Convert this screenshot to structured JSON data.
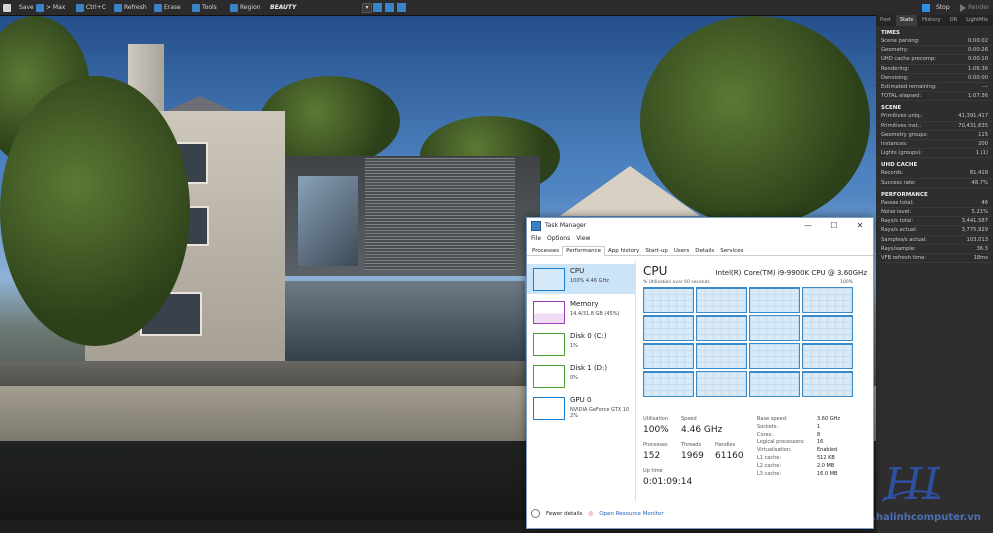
{
  "toolbar": {
    "save": "Save",
    "max": "> Max",
    "ctrlc": "Ctrl+C",
    "refresh": "Refresh",
    "erase": "Erase",
    "tools": "Tools",
    "region": "Region",
    "region_name": "BEAUTY",
    "stop": "Stop",
    "render": "Render"
  },
  "panel": {
    "tabs": [
      "Post",
      "Stats",
      "History",
      "DR",
      "LightMix"
    ],
    "active_tab": "Stats",
    "sections": [
      {
        "title": "TIMES",
        "rows": [
          [
            "Scene parsing:",
            "0:00:02"
          ],
          [
            "Geometry:",
            "0:00:26"
          ],
          [
            "UHD cache precomp:",
            "0:00:10"
          ],
          [
            "Rendering:",
            "1:06:36"
          ],
          [
            "Denoising:",
            "0:00:00"
          ],
          [
            "Estimated remaining:",
            "---"
          ],
          [
            "TOTAL elapsed:",
            "1:07:36"
          ]
        ]
      },
      {
        "title": "SCENE",
        "rows": [
          [
            "Primitives uniq.:",
            "41,391,417"
          ],
          [
            "Primitives inst.:",
            "70,431,635"
          ],
          [
            "Geometry groups:",
            "115"
          ],
          [
            "Instances:",
            "200"
          ],
          [
            "Lights (groups):",
            "1 (1)"
          ]
        ]
      },
      {
        "title": "UHD CACHE",
        "rows": [
          [
            "Records:",
            "81,418"
          ],
          [
            "Success rate:",
            "48.7%"
          ]
        ]
      },
      {
        "title": "PERFORMANCE",
        "rows": [
          [
            "Passes total:",
            "46"
          ],
          [
            "Noise level:",
            "5.21%"
          ],
          [
            "Rays/s total:",
            "3,441,587"
          ],
          [
            "Rays/s actual:",
            "3,775,929"
          ],
          [
            "Samples/s actual:",
            "103,013"
          ],
          [
            "Rays/sample:",
            "36.3"
          ],
          [
            "VFB refresh time:",
            "18ms"
          ]
        ]
      }
    ]
  },
  "watermark": "www.halinhcomputer.vn",
  "logo": "HL",
  "tm": {
    "title": "Task Manager",
    "menu": [
      "File",
      "Options",
      "View"
    ],
    "tabs": [
      "Processes",
      "Performance",
      "App history",
      "Start-up",
      "Users",
      "Details",
      "Services"
    ],
    "active_tab": "Performance",
    "resources": [
      {
        "name": "CPU",
        "sub": "100% 4.46 GHz",
        "color": "#1a7fd1"
      },
      {
        "name": "Memory",
        "sub": "14.4/31.8 GB (45%)",
        "color": "#a139b8"
      },
      {
        "name": "Disk 0 (C:)",
        "sub": "1%",
        "color": "#4aa02c"
      },
      {
        "name": "Disk 1 (D:)",
        "sub": "0%",
        "color": "#4aa02c"
      },
      {
        "name": "GPU 0",
        "sub": "NVIDIA GeForce GTX 10",
        "sub2": "2%",
        "color": "#1a7fd1"
      }
    ],
    "cpu_title": "CPU",
    "cpu_model": "Intel(R) Core(TM) i9-9900K CPU @ 3.60GHz",
    "util_label": "% Utilisation over 60 seconds",
    "util_max": "100%",
    "utilisation_label": "Utilisation",
    "utilisation": "100%",
    "speed_label": "Speed",
    "speed": "4.46 GHz",
    "processes_label": "Processes",
    "processes": "152",
    "threads_label": "Threads",
    "threads": "1969",
    "handles_label": "Handles",
    "handles": "61160",
    "uptime_label": "Up time",
    "uptime": "0:01:09:14",
    "specs": [
      [
        "Base speed:",
        "3.60 GHz"
      ],
      [
        "Sockets:",
        "1"
      ],
      [
        "Cores:",
        "8"
      ],
      [
        "Logical processors:",
        "16"
      ],
      [
        "Virtualisation:",
        "Enabled"
      ],
      [
        "L1 cache:",
        "512 KB"
      ],
      [
        "L2 cache:",
        "2.0 MB"
      ],
      [
        "L3 cache:",
        "16.0 MB"
      ]
    ],
    "fewer_details": "Fewer details",
    "open_monitor": "Open Resource Monitor",
    "cpu_graph_levels": [
      0.95,
      0.97,
      0.96,
      0.98,
      0.97,
      0.96,
      0.98,
      0.97,
      0.96,
      0.97,
      0.98,
      0.96,
      0.97,
      0.98,
      0.96,
      0.97
    ]
  }
}
